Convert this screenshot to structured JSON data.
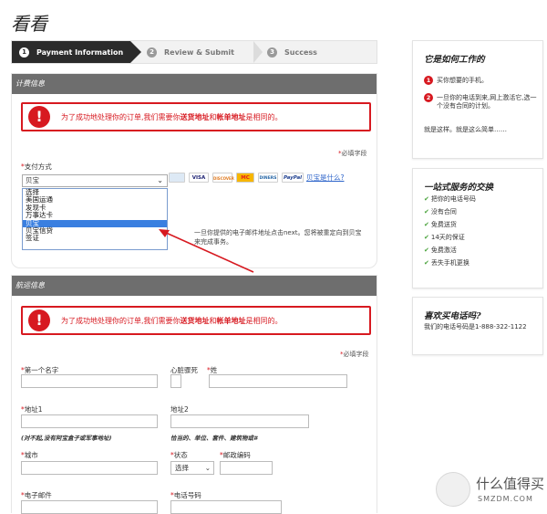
{
  "page_title": "看看",
  "steps": [
    {
      "num": "1",
      "label": "Payment Information"
    },
    {
      "num": "2",
      "label": "Review & Submit"
    },
    {
      "num": "3",
      "label": "Success"
    }
  ],
  "billing": {
    "section_title": "计费信息",
    "error_prefix": "为了成功地处理你的订单,我们需要你",
    "error_bold1": "送货地址",
    "error_mid": "和",
    "error_bold2": "帐单地址",
    "error_suffix": "是相同的。",
    "required_note": "必填字段",
    "payment_label": "支付方式",
    "payment_selected": "贝宝",
    "payment_options": [
      "选择",
      "美国运通",
      "发现卡",
      "万事达卡",
      "贝宝",
      "贝宝信贷",
      "签证"
    ],
    "payment_logos": [
      "AMEX",
      "VISA",
      "DISCOVER",
      "MC",
      "DINERS",
      "PayPal"
    ],
    "paypal_link": "贝宝是什么?",
    "note": "一旦你提供的电子邮件地址点击next。您将被重定向到贝宝来完成事务。"
  },
  "shipping": {
    "section_title": "航运信息",
    "error_prefix": "为了成功地处理你的订单,我们需要你",
    "error_bold1": "送货地址",
    "error_mid": "和",
    "error_bold2": "帐单地址",
    "error_suffix": "是相同的。",
    "required_note": "必填字段",
    "first_name_label": "第一个名字",
    "middle_initial_label": "心脏骤死",
    "last_name_label": "姓",
    "address1_label": "地址1",
    "address1_hint": "(对不起,没有阿宝盒子或军事地址)",
    "address2_label": "地址2",
    "address2_hint": "恰当的、单位、套件、建筑物或#",
    "city_label": "城市",
    "state_label": "状态",
    "state_value": "选择",
    "zip_label": "邮政编码",
    "email_label": "电子邮件",
    "phone_label": "电话号码"
  },
  "sidebar": {
    "how_title": "它是如何工作的",
    "how_steps": [
      {
        "num": "1",
        "text": "买你想要的手机。"
      },
      {
        "num": "2",
        "text": "一旦你的电话到来,网上激活它,选一个没有合同的计划。"
      }
    ],
    "how_footer": "就是这样。就是这么简单……",
    "one_stop_title": "一站式服务的交换",
    "one_stop_items": [
      "把你的电话号码",
      "没有合同",
      "免费送货",
      "14天的保证",
      "免费激活",
      "丢失手机更换"
    ],
    "like_title": "喜欢买电话吗?",
    "like_text": "我们的电话号码是1-888-322-1122"
  },
  "watermark": {
    "icon": "值",
    "cn": "什么值得买",
    "en": "SMZDM.COM"
  },
  "colors": {
    "accent_red": "#d71920",
    "header_grey": "#6e6e6e",
    "step_active": "#2b2b2b",
    "link_blue": "#2a62c9",
    "check_green": "#4aa33c"
  }
}
